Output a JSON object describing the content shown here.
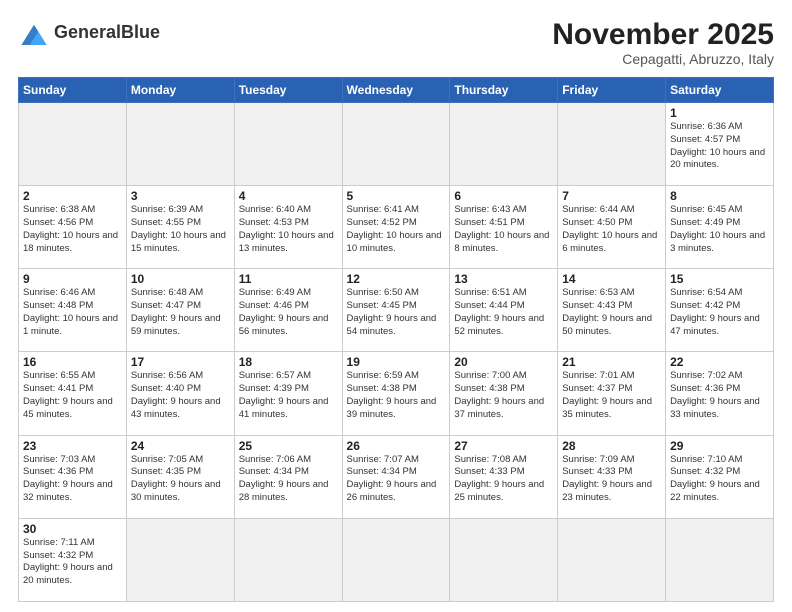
{
  "header": {
    "logo_text_normal": "General",
    "logo_text_bold": "Blue",
    "month_year": "November 2025",
    "location": "Cepagatti, Abruzzo, Italy"
  },
  "weekdays": [
    "Sunday",
    "Monday",
    "Tuesday",
    "Wednesday",
    "Thursday",
    "Friday",
    "Saturday"
  ],
  "weeks": [
    [
      {
        "day": "",
        "info": ""
      },
      {
        "day": "",
        "info": ""
      },
      {
        "day": "",
        "info": ""
      },
      {
        "day": "",
        "info": ""
      },
      {
        "day": "",
        "info": ""
      },
      {
        "day": "",
        "info": ""
      },
      {
        "day": "1",
        "info": "Sunrise: 6:36 AM\nSunset: 4:57 PM\nDaylight: 10 hours and 20 minutes."
      }
    ],
    [
      {
        "day": "2",
        "info": "Sunrise: 6:38 AM\nSunset: 4:56 PM\nDaylight: 10 hours and 18 minutes."
      },
      {
        "day": "3",
        "info": "Sunrise: 6:39 AM\nSunset: 4:55 PM\nDaylight: 10 hours and 15 minutes."
      },
      {
        "day": "4",
        "info": "Sunrise: 6:40 AM\nSunset: 4:53 PM\nDaylight: 10 hours and 13 minutes."
      },
      {
        "day": "5",
        "info": "Sunrise: 6:41 AM\nSunset: 4:52 PM\nDaylight: 10 hours and 10 minutes."
      },
      {
        "day": "6",
        "info": "Sunrise: 6:43 AM\nSunset: 4:51 PM\nDaylight: 10 hours and 8 minutes."
      },
      {
        "day": "7",
        "info": "Sunrise: 6:44 AM\nSunset: 4:50 PM\nDaylight: 10 hours and 6 minutes."
      },
      {
        "day": "8",
        "info": "Sunrise: 6:45 AM\nSunset: 4:49 PM\nDaylight: 10 hours and 3 minutes."
      }
    ],
    [
      {
        "day": "9",
        "info": "Sunrise: 6:46 AM\nSunset: 4:48 PM\nDaylight: 10 hours and 1 minute."
      },
      {
        "day": "10",
        "info": "Sunrise: 6:48 AM\nSunset: 4:47 PM\nDaylight: 9 hours and 59 minutes."
      },
      {
        "day": "11",
        "info": "Sunrise: 6:49 AM\nSunset: 4:46 PM\nDaylight: 9 hours and 56 minutes."
      },
      {
        "day": "12",
        "info": "Sunrise: 6:50 AM\nSunset: 4:45 PM\nDaylight: 9 hours and 54 minutes."
      },
      {
        "day": "13",
        "info": "Sunrise: 6:51 AM\nSunset: 4:44 PM\nDaylight: 9 hours and 52 minutes."
      },
      {
        "day": "14",
        "info": "Sunrise: 6:53 AM\nSunset: 4:43 PM\nDaylight: 9 hours and 50 minutes."
      },
      {
        "day": "15",
        "info": "Sunrise: 6:54 AM\nSunset: 4:42 PM\nDaylight: 9 hours and 47 minutes."
      }
    ],
    [
      {
        "day": "16",
        "info": "Sunrise: 6:55 AM\nSunset: 4:41 PM\nDaylight: 9 hours and 45 minutes."
      },
      {
        "day": "17",
        "info": "Sunrise: 6:56 AM\nSunset: 4:40 PM\nDaylight: 9 hours and 43 minutes."
      },
      {
        "day": "18",
        "info": "Sunrise: 6:57 AM\nSunset: 4:39 PM\nDaylight: 9 hours and 41 minutes."
      },
      {
        "day": "19",
        "info": "Sunrise: 6:59 AM\nSunset: 4:38 PM\nDaylight: 9 hours and 39 minutes."
      },
      {
        "day": "20",
        "info": "Sunrise: 7:00 AM\nSunset: 4:38 PM\nDaylight: 9 hours and 37 minutes."
      },
      {
        "day": "21",
        "info": "Sunrise: 7:01 AM\nSunset: 4:37 PM\nDaylight: 9 hours and 35 minutes."
      },
      {
        "day": "22",
        "info": "Sunrise: 7:02 AM\nSunset: 4:36 PM\nDaylight: 9 hours and 33 minutes."
      }
    ],
    [
      {
        "day": "23",
        "info": "Sunrise: 7:03 AM\nSunset: 4:36 PM\nDaylight: 9 hours and 32 minutes."
      },
      {
        "day": "24",
        "info": "Sunrise: 7:05 AM\nSunset: 4:35 PM\nDaylight: 9 hours and 30 minutes."
      },
      {
        "day": "25",
        "info": "Sunrise: 7:06 AM\nSunset: 4:34 PM\nDaylight: 9 hours and 28 minutes."
      },
      {
        "day": "26",
        "info": "Sunrise: 7:07 AM\nSunset: 4:34 PM\nDaylight: 9 hours and 26 minutes."
      },
      {
        "day": "27",
        "info": "Sunrise: 7:08 AM\nSunset: 4:33 PM\nDaylight: 9 hours and 25 minutes."
      },
      {
        "day": "28",
        "info": "Sunrise: 7:09 AM\nSunset: 4:33 PM\nDaylight: 9 hours and 23 minutes."
      },
      {
        "day": "29",
        "info": "Sunrise: 7:10 AM\nSunset: 4:32 PM\nDaylight: 9 hours and 22 minutes."
      }
    ],
    [
      {
        "day": "30",
        "info": "Sunrise: 7:11 AM\nSunset: 4:32 PM\nDaylight: 9 hours and 20 minutes."
      },
      {
        "day": "",
        "info": ""
      },
      {
        "day": "",
        "info": ""
      },
      {
        "day": "",
        "info": ""
      },
      {
        "day": "",
        "info": ""
      },
      {
        "day": "",
        "info": ""
      },
      {
        "day": "",
        "info": ""
      }
    ]
  ]
}
